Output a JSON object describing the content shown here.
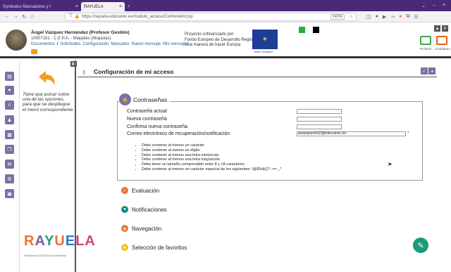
{
  "browser": {
    "tab_inactive": "Symbaloo Marcadores y I",
    "tab_active": "RAYUELA",
    "tab_close": "×",
    "new_tab": "+",
    "url": "https://rayuela.educarex.es/modulo_acceso/Contenedor.jsp",
    "zoom": "140%"
  },
  "header": {
    "user_name": "Ángel Vázquez Hernández (Profesor Gestión)",
    "school": "10007161 - C.E.P.A. - Miajadas (Miajadas)",
    "menu": [
      "Documentos",
      "Solicitudes",
      "Configuración",
      "Manuales",
      "Nuevo mensaje",
      "Mis mensajes"
    ],
    "menu_separator": "/",
    "project_lines": [
      "Proyecto cofinanciado por",
      "Fondo Europeo de Desarrollo Regional",
      "Una manera de hacer Europa"
    ],
    "eu_caption": "Unión Europea",
    "role_profesor": "Profesor",
    "role_ciudadano": "Ciudadano"
  },
  "left_panel": {
    "help_text": "Tiene que pulsar sobre una de las opciones, para que se despliegue el menú correspondiente",
    "logo_letters": [
      "R",
      "A",
      "Y",
      "U",
      "E",
      "LA"
    ],
    "logo_subtitle": "Plataforma EDUCATIVA Extremeña"
  },
  "main": {
    "title": "Configuración de mi acceso",
    "password_section": {
      "legend": "Contraseñas",
      "fields": [
        {
          "label": "Contraseña actual",
          "value": ""
        },
        {
          "label": "Nueva contraseña",
          "value": ""
        },
        {
          "label": "Confirma nueva contraseña",
          "value": ""
        },
        {
          "label": "Correo electrónico de recuperación/notificación",
          "value": "avazquezh02@educarex.es"
        }
      ],
      "required_mark": "*",
      "rules": [
        "Debe contener al menos un carácter",
        "Debe contener al menos un dígito",
        "Debe contener al menos una letra minúscula",
        "Debe contener al menos una letra mayúscula",
        "Debe tener un tamaño comprendido entre 8 y 18 caracteres",
        "Debe contener al menos un carácter especial de los siguientes: !@$%&()?.:+=-_*"
      ]
    },
    "sections": [
      {
        "label": "Evaluación",
        "color": "#e8733a"
      },
      {
        "label": "Notificaciones",
        "color": "#1a8a8a"
      },
      {
        "label": "Navegación",
        "color": "#e8733a"
      },
      {
        "label": "Selección de favoritos",
        "color": "#f2c21c"
      }
    ]
  },
  "colors": {
    "accent": "#7b6fa3",
    "browser_tabbar": "#4a2a78",
    "fab": "#1a9a7a"
  }
}
